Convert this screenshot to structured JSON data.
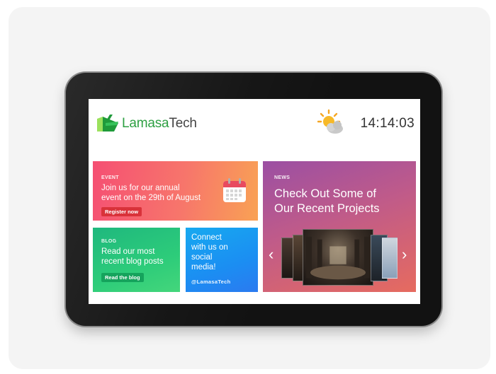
{
  "header": {
    "logo": {
      "part1": "Lamasa",
      "part2": "Tech"
    },
    "clock": "14:14:03",
    "weather_icon": "partly-cloudy-icon"
  },
  "tiles": {
    "event": {
      "label": "EVENT",
      "line1": "Join us for our annual",
      "line2": "event on the 29th of August",
      "button": "Register now",
      "icon": "calendar-icon"
    },
    "news": {
      "label": "NEWS",
      "line1": "Check Out Some of",
      "line2": "Our Recent Projects",
      "prev": "‹",
      "next": "›"
    },
    "blog": {
      "label": "BLOG",
      "line1": "Read our most",
      "line2": "recent blog posts",
      "button": "Read the blog"
    },
    "social": {
      "line1": "Connect",
      "line2": "with us on",
      "line3": "social",
      "line4": "media!",
      "handle": "@LamasaTech"
    }
  },
  "colors": {
    "logo_green": "#2ea043",
    "event_pill": "#d9323a",
    "blog_pill": "#15a35c"
  }
}
